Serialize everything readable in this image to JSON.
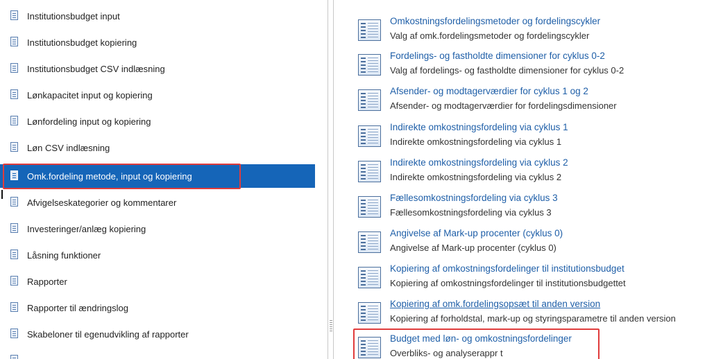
{
  "left_nav": {
    "items": [
      {
        "label": "Institutionsbudget input"
      },
      {
        "label": "Institutionsbudget kopiering"
      },
      {
        "label": "Institutionsbudget CSV indlæsning"
      },
      {
        "label": "Lønkapacitet input og kopiering"
      },
      {
        "label": "Lønfordeling input og kopiering"
      },
      {
        "label": "Løn CSV indlæsning"
      },
      {
        "label": "Omk.fordeling metode, input og kopiering",
        "selected": true
      },
      {
        "label": "Afvigelseskategorier og kommentarer"
      },
      {
        "label": "Investeringer/anlæg kopiering"
      },
      {
        "label": "Låsning funktioner"
      },
      {
        "label": "Rapporter"
      },
      {
        "label": "Rapporter til ændringslog"
      },
      {
        "label": "Skabeloner til egenudvikling af rapporter"
      }
    ],
    "selected_color": "#1565b8",
    "highlight_color": "#e03c3c"
  },
  "right_panel": {
    "tiles": [
      {
        "title": "Omkostningsfordelingsmetoder og fordelingscykler",
        "subtitle": "Valg af omk.fordelingsmetoder og fordelingscykler"
      },
      {
        "title": "Fordelings- og fastholdte dimensioner for cyklus 0-2",
        "subtitle": "Valg af fordelings- og fastholdte dimensioner for cyklus 0-2"
      },
      {
        "title": "Afsender- og modtagerværdier for cyklus 1 og 2",
        "subtitle": "Afsender- og modtagerværdier for fordelingsdimensioner"
      },
      {
        "title": "Indirekte omkostningsfordeling via cyklus 1",
        "subtitle": "Indirekte omkostningsfordeling via cyklus 1"
      },
      {
        "title": "Indirekte omkostningsfordeling via cyklus 2",
        "subtitle": "Indirekte omkostningsfordeling via cyklus 2"
      },
      {
        "title": "Fællesomkostningsfordeling via cyklus 3",
        "subtitle": "Fællesomkostningsfordeling via cyklus 3"
      },
      {
        "title": "Angivelse af Mark-up procenter (cyklus 0)",
        "subtitle": "Angivelse af Mark-up procenter (cyklus 0)"
      },
      {
        "title": "Kopiering af omkostningsfordelinger til institutionsbudget",
        "subtitle": "Kopiering af omkostningsfordelinger til institutionsbudgettet"
      },
      {
        "title": "Kopiering af omk.fordelingsopsæt til anden version",
        "subtitle": "Kopiering af forholdstal, mark-up og styringsparametre til anden version",
        "underlined": true
      },
      {
        "title": "Budget med løn- og omkostningsfordelinger",
        "subtitle": "Overbliks- og analyserappr t",
        "highlighted": true
      }
    ],
    "link_color": "#1f5fa8"
  }
}
